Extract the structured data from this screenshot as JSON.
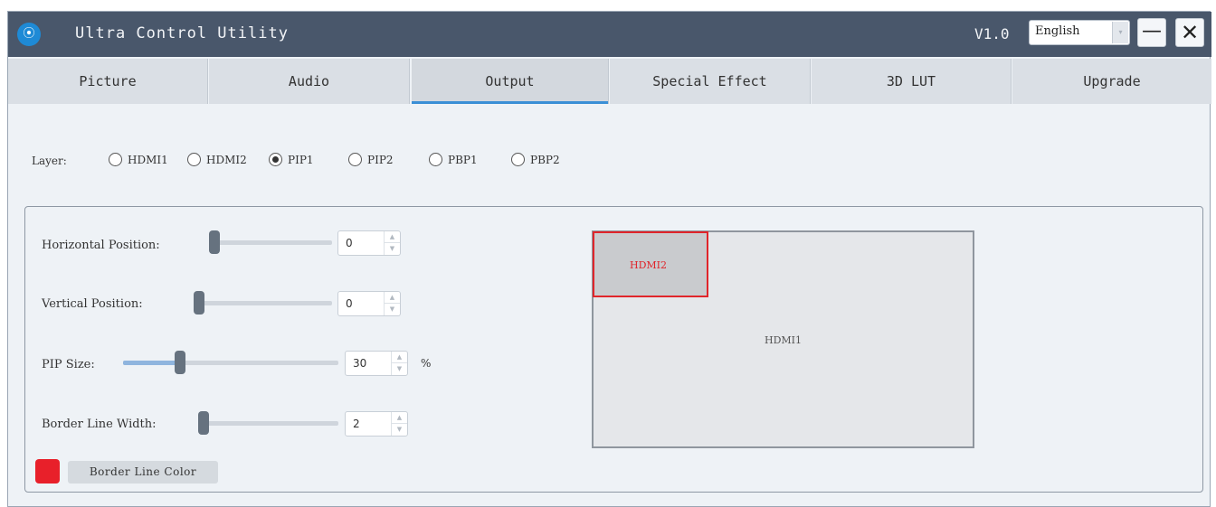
{
  "app": {
    "title": "Ultra Control Utility",
    "version": "V1.0",
    "language": "English",
    "icon": "app-logo-icon",
    "minimize_icon": "—",
    "close_icon": "✕",
    "dropdown_icon": "▾"
  },
  "tabs": [
    {
      "label": "Picture",
      "active": false
    },
    {
      "label": "Audio",
      "active": false
    },
    {
      "label": "Output",
      "active": true
    },
    {
      "label": "Special Effect",
      "active": false
    },
    {
      "label": "3D LUT",
      "active": false
    },
    {
      "label": "Upgrade",
      "active": false
    }
  ],
  "layer": {
    "label": "Layer:",
    "options": [
      "HDMI1",
      "HDMI2",
      "PIP1",
      "PIP2",
      "PBP1",
      "PBP2"
    ],
    "selected": "PIP1"
  },
  "controls": {
    "horizontal_position": {
      "label": "Horizontal Position:",
      "value": "0",
      "slider_fraction": 0.0
    },
    "vertical_position": {
      "label": "Vertical Position:",
      "value": "0",
      "slider_fraction": 0.0
    },
    "pip_size": {
      "label": "PIP Size:",
      "value": "30",
      "unit": "%",
      "slider_fraction": 0.27
    },
    "border_line_width": {
      "label": "Border Line Width:",
      "value": "2",
      "slider_fraction": 0.0
    },
    "border_line_color": {
      "label": "Border Line Color",
      "color": "#e8202a"
    }
  },
  "preview": {
    "main_label": "HDMI1",
    "pip_label": "HDMI2",
    "pip_border_color": "#e0252b"
  },
  "colors": {
    "titlebar": "#49576b",
    "accent": "#3a8fd6"
  }
}
